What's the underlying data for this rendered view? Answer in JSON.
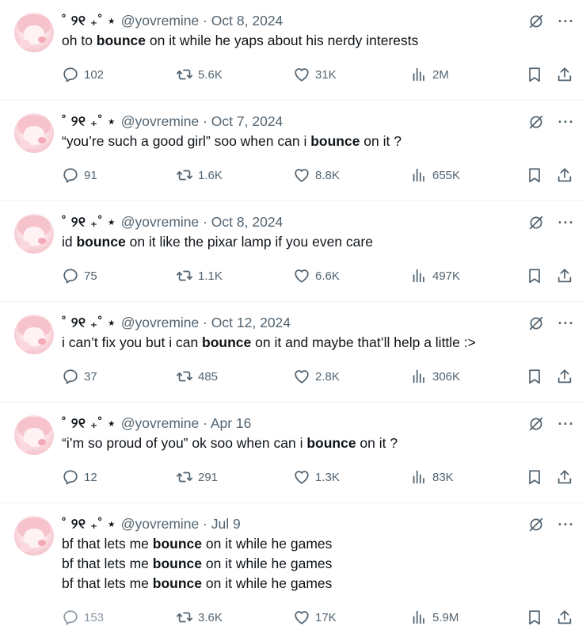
{
  "tweets": [
    {
      "display_name": "˚ ୨୧ ₊˚ ⋆",
      "meta": "@yovremine · Oct 8, 2024",
      "lines": [
        {
          "before": "oh to ",
          "bold": "bounce",
          "after": " on it while he yaps about his nerdy interests"
        }
      ],
      "replies": "102",
      "retweets": "5.6K",
      "likes": "31K",
      "views": "2M"
    },
    {
      "display_name": "˚ ୨୧ ₊˚ ⋆",
      "meta": "@yovremine · Oct 7, 2024",
      "lines": [
        {
          "before": "“you’re such a good girl” soo when can i ",
          "bold": "bounce",
          "after": " on it ?"
        }
      ],
      "replies": "91",
      "retweets": "1.6K",
      "likes": "8.8K",
      "views": "655K"
    },
    {
      "display_name": "˚ ୨୧ ₊˚ ⋆",
      "meta": "@yovremine · Oct 8, 2024",
      "lines": [
        {
          "before": "id ",
          "bold": "bounce",
          "after": " on it like the pixar lamp if you even care"
        }
      ],
      "replies": "75",
      "retweets": "1.1K",
      "likes": "6.6K",
      "views": "497K"
    },
    {
      "display_name": "˚ ୨୧ ₊˚ ⋆",
      "meta": "@yovremine · Oct 12, 2024",
      "lines": [
        {
          "before": "i can’t fix you but i can ",
          "bold": "bounce",
          "after": " on it and maybe that’ll help a little :>"
        }
      ],
      "replies": "37",
      "retweets": "485",
      "likes": "2.8K",
      "views": "306K"
    },
    {
      "display_name": "˚ ୨୧ ₊˚ ⋆",
      "meta": "@yovremine · Apr 16",
      "lines": [
        {
          "before": "“i’m so proud of you” ok soo when can i ",
          "bold": "bounce",
          "after": " on it ?"
        }
      ],
      "replies": "12",
      "retweets": "291",
      "likes": "1.3K",
      "views": "83K"
    },
    {
      "display_name": "˚ ୨୧ ₊˚ ⋆",
      "meta": "@yovremine · Jul 9",
      "lines": [
        {
          "before": "bf that lets me ",
          "bold": "bounce",
          "after": " on it while he games"
        },
        {
          "before": "bf that lets me ",
          "bold": "bounce",
          "after": " on it while he games"
        },
        {
          "before": "bf that lets me ",
          "bold": "bounce",
          "after": " on it while he games"
        }
      ],
      "replies": "153",
      "retweets": "3.6K",
      "likes": "17K",
      "views": "5.9M",
      "reply_faded": true
    }
  ],
  "colors": {
    "text": "#0f1419",
    "muted": "#536471",
    "divider": "#eff3f4"
  }
}
